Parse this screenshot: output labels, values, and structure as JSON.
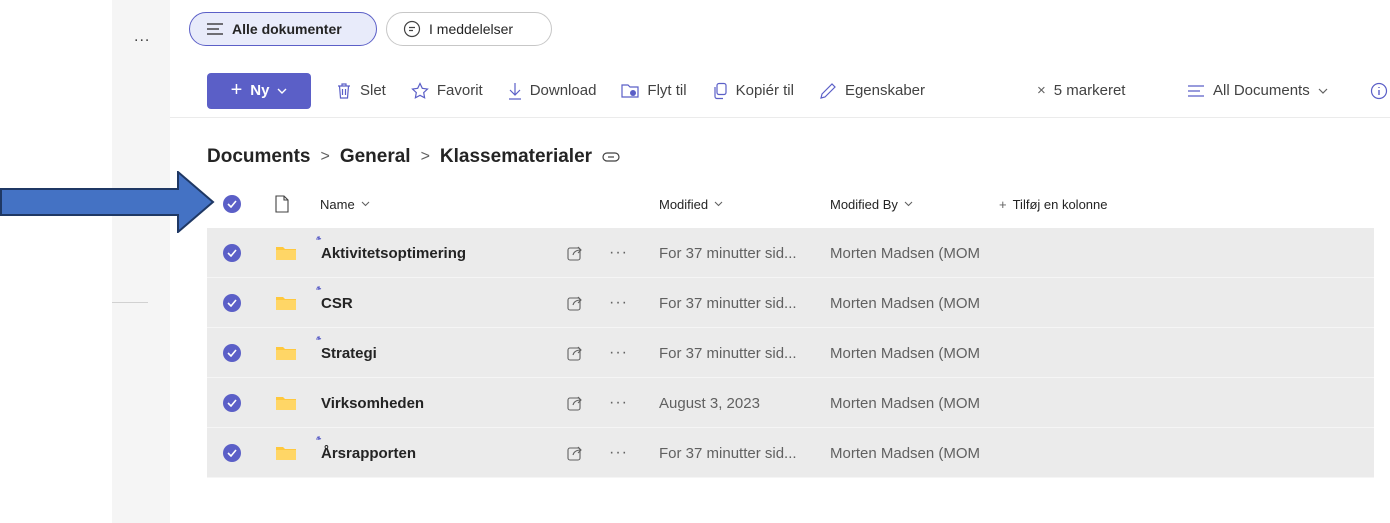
{
  "rail": {
    "more_label": "..."
  },
  "tabs": [
    {
      "label": "Alle dokumenter",
      "active": true
    },
    {
      "label": "I meddelelser",
      "active": false
    }
  ],
  "toolbar": {
    "new_label": "Ny",
    "delete_label": "Slet",
    "favorite_label": "Favorit",
    "download_label": "Download",
    "move_label": "Flyt til",
    "copy_label": "Kopiér til",
    "properties_label": "Egenskaber",
    "selected_label": "5 markeret",
    "view_label": "All Documents"
  },
  "breadcrumb": [
    "Documents",
    "General",
    "Klassematerialer"
  ],
  "columns": {
    "name": "Name",
    "modified": "Modified",
    "modified_by": "Modified By",
    "add_column": "Tilføj en kolonne"
  },
  "rows": [
    {
      "name": "Aktivitetsoptimering",
      "modified": "For 37 minutter sid...",
      "modified_by": "Morten Madsen (MOM",
      "is_new": true
    },
    {
      "name": "CSR",
      "modified": "For 37 minutter sid...",
      "modified_by": "Morten Madsen (MOM",
      "is_new": true
    },
    {
      "name": "Strategi",
      "modified": "For 37 minutter sid...",
      "modified_by": "Morten Madsen (MOM",
      "is_new": true
    },
    {
      "name": "Virksomheden",
      "modified": "August 3, 2023",
      "modified_by": "Morten Madsen (MOM",
      "is_new": false
    },
    {
      "name": "Årsrapporten",
      "modified": "For 37 minutter sid...",
      "modified_by": "Morten Madsen (MOM",
      "is_new": true
    }
  ],
  "colors": {
    "accent": "#5b5fc7",
    "folder": "#ffc83d",
    "arrow_fill": "#4472c4",
    "arrow_stroke": "#1f3864",
    "row_bg": "#ebebeb"
  }
}
